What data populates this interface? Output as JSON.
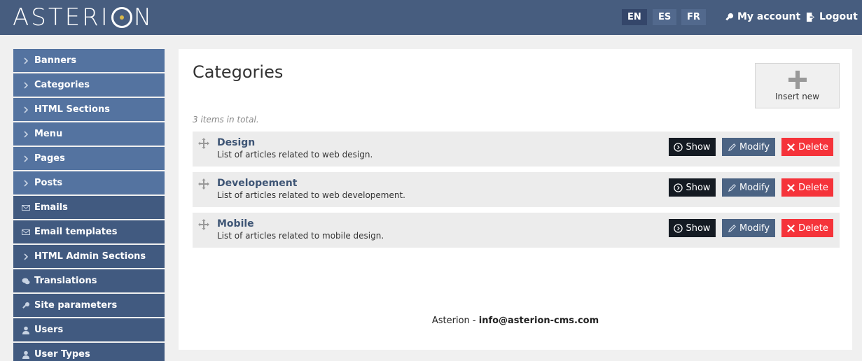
{
  "header": {
    "logo_text_a": "ASTERI",
    "logo_text_b": "N",
    "languages": [
      "EN",
      "ES",
      "FR"
    ],
    "active_language": "EN",
    "my_account": "My account",
    "logout": "Logout"
  },
  "sidebar": {
    "items": [
      {
        "label": "Banners",
        "icon": "chevron-right-icon"
      },
      {
        "label": "Categories",
        "icon": "chevron-right-icon"
      },
      {
        "label": "HTML Sections",
        "icon": "chevron-right-icon"
      },
      {
        "label": "Menu",
        "icon": "chevron-right-icon"
      },
      {
        "label": "Pages",
        "icon": "chevron-right-icon"
      },
      {
        "label": "Posts",
        "icon": "chevron-right-icon"
      },
      {
        "label": "Emails",
        "icon": "envelope-icon"
      },
      {
        "label": "Email templates",
        "icon": "envelope-icon"
      },
      {
        "label": "HTML Admin Sections",
        "icon": "chevron-right-icon"
      },
      {
        "label": "Translations",
        "icon": "speech-bubbles-icon"
      },
      {
        "label": "Site parameters",
        "icon": "key-icon"
      },
      {
        "label": "Users",
        "icon": "user-icon"
      },
      {
        "label": "User Types",
        "icon": "user-icon"
      }
    ]
  },
  "main": {
    "title": "Categories",
    "insert_label": "Insert new",
    "total_text": "3 items in total.",
    "actions": {
      "show": "Show",
      "modify": "Modify",
      "delete": "Delete"
    },
    "rows": [
      {
        "name": "Design",
        "description": "List of articles related to web design."
      },
      {
        "name": "Developement",
        "description": "List of articles related to web developement."
      },
      {
        "name": "Mobile",
        "description": "List of articles related to mobile design."
      }
    ]
  },
  "footer": {
    "brand": "Asterion - ",
    "email": "info@asterion-cms.com"
  },
  "colors": {
    "topbar": "#475d7f",
    "sidebar_light": "#5473a0",
    "sidebar_dark": "#415a80",
    "show_button": "#141a22",
    "modify_button": "#4b6383",
    "delete_button": "#f5333a"
  }
}
